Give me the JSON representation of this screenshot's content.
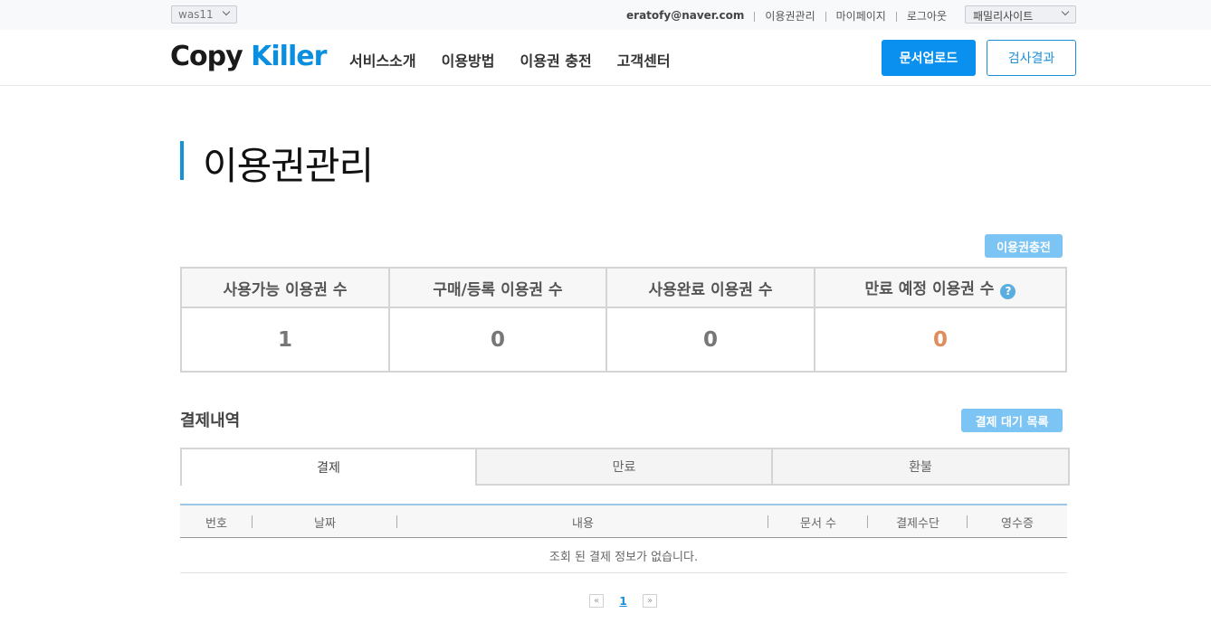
{
  "topbar": {
    "server": "was11",
    "email": "eratofy@naver.com",
    "links": [
      "이용권관리",
      "마이페이지",
      "로그아웃"
    ],
    "family_site": "패밀리사이트"
  },
  "header": {
    "logo_part1": "Copy",
    "logo_part2": "Killer",
    "nav": [
      "서비스소개",
      "이용방법",
      "이용권 충전",
      "고객센터"
    ],
    "upload_label": "문서업로드",
    "result_label": "검사결과"
  },
  "page": {
    "title": "이용권관리",
    "charge_label": "이용권충전"
  },
  "stats": {
    "headers": [
      "사용가능 이용권 수",
      "구매/등록 이용권 수",
      "사용완료 이용권 수",
      "만료 예정 이용권 수"
    ],
    "values": [
      "1",
      "0",
      "0",
      "0"
    ],
    "help_symbol": "?"
  },
  "payments": {
    "title": "결제내역",
    "pending_label": "결제 대기 목록",
    "tabs": [
      "결제",
      "만료",
      "환불"
    ],
    "columns": [
      "번호",
      "날짜",
      "내용",
      "문서 수",
      "결제수단",
      "영수증"
    ],
    "empty_message": "조회 된 결제 정보가 없습니다."
  },
  "pager": {
    "prev": "«",
    "current": "1",
    "next": "»"
  },
  "colors": {
    "accent": "#0a91ef",
    "light_button": "#7cc4f3",
    "expiring": "#e08d5c"
  }
}
